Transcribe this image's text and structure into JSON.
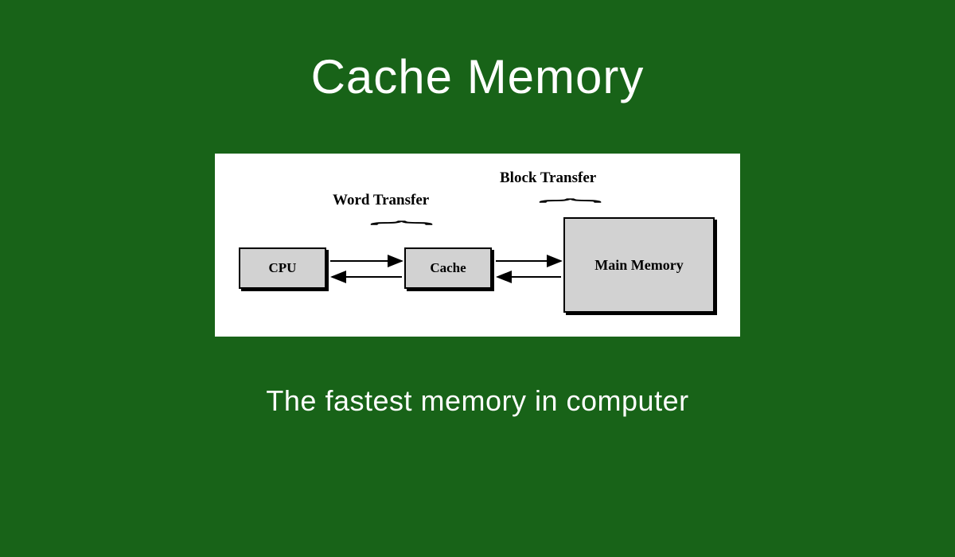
{
  "title": "Cache Memory",
  "subtitle": "The fastest memory in computer",
  "diagram": {
    "labels": {
      "word_transfer": "Word Transfer",
      "block_transfer": "Block Transfer"
    },
    "blocks": {
      "cpu": "CPU",
      "cache": "Cache",
      "main_memory": "Main Memory"
    }
  }
}
